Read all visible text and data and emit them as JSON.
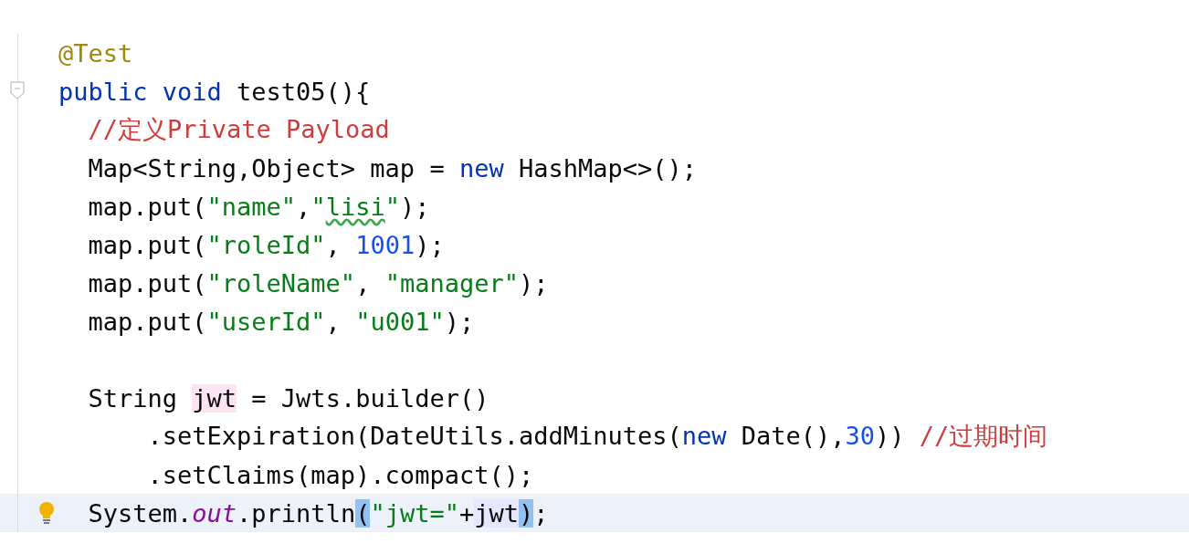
{
  "editor": {
    "lines": [
      {
        "current": false,
        "tokens": [
          {
            "kind": "annotation",
            "text": "@Test"
          }
        ]
      },
      {
        "current": false,
        "kind": "fold",
        "tokens": [
          {
            "kind": "keyword",
            "text": "public void"
          },
          {
            "kind": "plain",
            "text": " test05(){"
          }
        ]
      },
      {
        "current": false,
        "tokens": [
          {
            "kind": "comment",
            "text": "  //定义Private Payload"
          }
        ]
      },
      {
        "current": false,
        "tokens": [
          {
            "kind": "plain",
            "text": "  Map<String,Object> map = "
          },
          {
            "kind": "keyword",
            "text": "new"
          },
          {
            "kind": "plain",
            "text": " HashMap<>();"
          }
        ]
      },
      {
        "current": false,
        "tokens": [
          {
            "kind": "plain",
            "text": "  map.put("
          },
          {
            "kind": "string",
            "text": "\"name\""
          },
          {
            "kind": "plain",
            "text": ","
          },
          {
            "kind": "string",
            "text": "\""
          },
          {
            "kind": "typo",
            "text": "lisi"
          },
          {
            "kind": "string",
            "text": "\""
          },
          {
            "kind": "plain",
            "text": ");"
          }
        ]
      },
      {
        "current": false,
        "tokens": [
          {
            "kind": "plain",
            "text": "  map.put("
          },
          {
            "kind": "string",
            "text": "\"roleId\""
          },
          {
            "kind": "plain",
            "text": ", "
          },
          {
            "kind": "number",
            "text": "1001"
          },
          {
            "kind": "plain",
            "text": ");"
          }
        ]
      },
      {
        "current": false,
        "tokens": [
          {
            "kind": "plain",
            "text": "  map.put("
          },
          {
            "kind": "string",
            "text": "\"roleName\""
          },
          {
            "kind": "plain",
            "text": ", "
          },
          {
            "kind": "string",
            "text": "\"manager\""
          },
          {
            "kind": "plain",
            "text": ");"
          }
        ]
      },
      {
        "current": false,
        "tokens": [
          {
            "kind": "plain",
            "text": "  map.put("
          },
          {
            "kind": "string",
            "text": "\"userId\""
          },
          {
            "kind": "plain",
            "text": ", "
          },
          {
            "kind": "string",
            "text": "\"u001\""
          },
          {
            "kind": "plain",
            "text": ");"
          }
        ]
      },
      {
        "current": false
      },
      {
        "current": false,
        "tokens": [
          {
            "kind": "plain",
            "text": "  String "
          },
          {
            "kind": "declaration",
            "text": "jwt"
          },
          {
            "kind": "plain",
            "text": " = Jwts.builder()"
          }
        ]
      },
      {
        "current": false,
        "tokens": [
          {
            "kind": "plain",
            "text": "      .setExpiration(DateUtils.addMinutes("
          },
          {
            "kind": "keyword",
            "text": "new"
          },
          {
            "kind": "plain",
            "text": " Date(),"
          },
          {
            "kind": "number",
            "text": "30"
          },
          {
            "kind": "plain",
            "text": ")) "
          },
          {
            "kind": "comment",
            "text": "//过期时间"
          }
        ]
      },
      {
        "current": false,
        "tokens": [
          {
            "kind": "plain",
            "text": "      .setClaims(map).compact();"
          }
        ]
      },
      {
        "current": true,
        "kind": "bulb",
        "tokens": [
          {
            "kind": "plain",
            "text": "  System."
          },
          {
            "kind": "field",
            "text": "out"
          },
          {
            "kind": "plain",
            "text": ".println"
          },
          {
            "kind": "brace",
            "text": "("
          },
          {
            "kind": "string",
            "text": "\"jwt=\""
          },
          {
            "kind": "plain",
            "text": "+"
          },
          {
            "kind": "usage",
            "text": "jwt"
          },
          {
            "kind": "brace",
            "text": ")"
          },
          {
            "kind": "plain",
            "text": ";"
          }
        ]
      }
    ]
  }
}
